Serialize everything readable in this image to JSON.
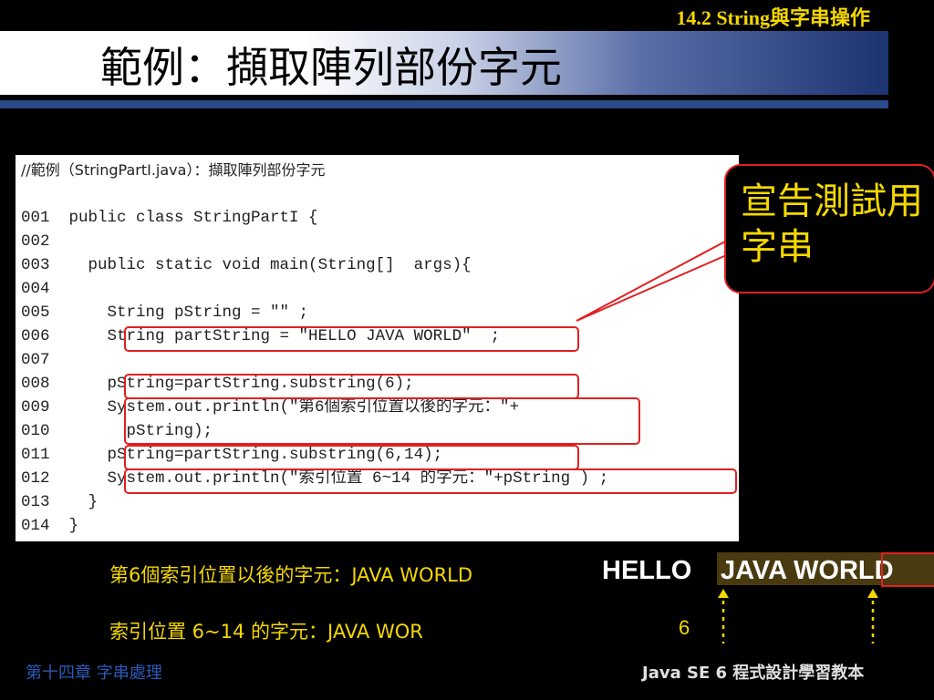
{
  "header": {
    "section_label": "14.2 String與字串操作",
    "title": "範例：擷取陣列部份字元"
  },
  "code": {
    "comment": "//範例（StringPartI.java）：擷取陣列部份字元",
    "lines": [
      {
        "num": "001",
        "code": "  public class StringPartI {"
      },
      {
        "num": "002",
        "code": ""
      },
      {
        "num": "003",
        "code": "    public static void main(String[]  args){"
      },
      {
        "num": "004",
        "code": ""
      },
      {
        "num": "005",
        "code": "      String pString = \"\" ;"
      },
      {
        "num": "006",
        "code": "      String partString = \"HELLO JAVA WORLD\"  ;"
      },
      {
        "num": "007",
        "code": ""
      },
      {
        "num": "008",
        "code": "      pString=partString.substring(6);"
      },
      {
        "num": "009",
        "code": "      System.out.println(\"第6個索引位置以後的字元：\"+"
      },
      {
        "num": "010",
        "code": "        pString);"
      },
      {
        "num": "011",
        "code": "      pString=partString.substring(6,14);"
      },
      {
        "num": "012",
        "code": "      System.out.println(\"索引位置 6~14 的字元：\"+pString ) ;"
      },
      {
        "num": "013",
        "code": "    }"
      },
      {
        "num": "014",
        "code": "  }"
      }
    ]
  },
  "callout": {
    "text": "宣告測試用字串"
  },
  "results": {
    "line1": "第6個索引位置以後的字元：JAVA WORLD",
    "line2": "索引位置 6~14 的字元：JAVA WOR"
  },
  "demo": {
    "plain": "HELLO",
    "highlighted": "JAVA WORLD",
    "index_label": "6"
  },
  "footer": {
    "left": "第十四章 字串處理",
    "right": "Java SE 6 程式設計學習教本"
  },
  "colors": {
    "accent_yellow": "#f5d800",
    "highlight_red": "#e02020",
    "title_blue": "#1c3471"
  }
}
